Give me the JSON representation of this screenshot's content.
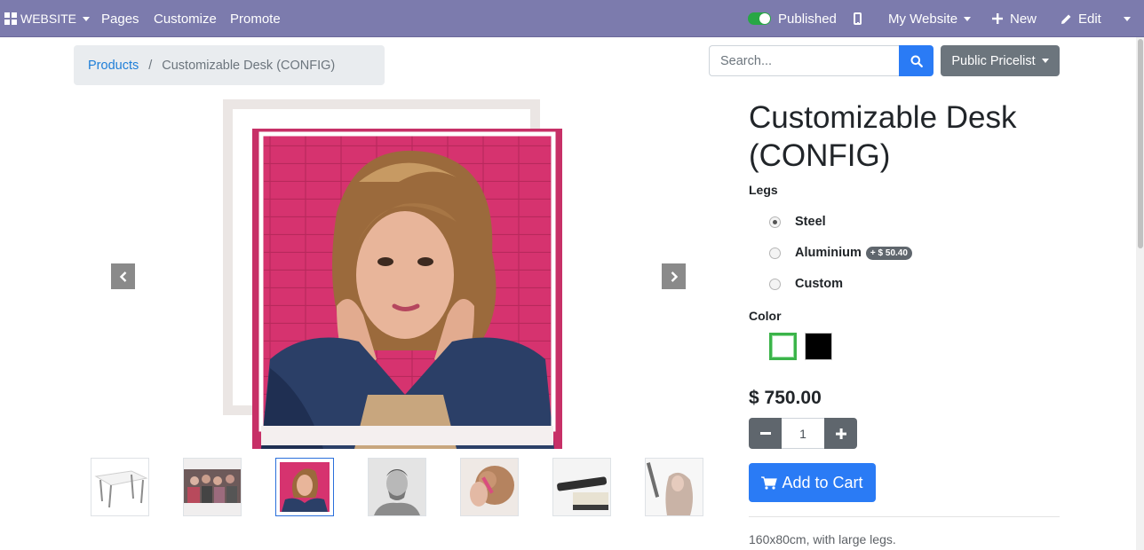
{
  "topbar": {
    "app_menu_label": "WEBSITE",
    "menu_items": [
      {
        "label": "Pages"
      },
      {
        "label": "Customize"
      },
      {
        "label": "Promote"
      }
    ],
    "published_label": "Published",
    "published": true,
    "website_selector_label": "My Website",
    "new_label": "New",
    "edit_label": "Edit",
    "background_color": "#7c7bad"
  },
  "breadcrumb": {
    "parent": "Products",
    "separator": "/",
    "current": "Customizable Desk (CONFIG)"
  },
  "search": {
    "placeholder": "Search...",
    "value": ""
  },
  "pricelist": {
    "label": "Public Pricelist"
  },
  "carousel": {
    "active_index": 2,
    "thumbnails": [
      {
        "subject": "white desk"
      },
      {
        "subject": "group photo"
      },
      {
        "subject": "woman pink wall"
      },
      {
        "subject": "man portrait"
      },
      {
        "subject": "hair styling"
      },
      {
        "subject": "hair straightener"
      },
      {
        "subject": "curling iron"
      }
    ]
  },
  "product": {
    "title": "Customizable Desk (CONFIG)",
    "legs_label": "Legs",
    "legs_options": [
      {
        "label": "Steel",
        "checked": true,
        "extra": ""
      },
      {
        "label": "Aluminium",
        "checked": false,
        "extra": "+ $ 50.40"
      },
      {
        "label": "Custom",
        "checked": false,
        "extra": ""
      }
    ],
    "color_label": "Color",
    "colors": [
      {
        "name": "white",
        "hex": "#ffffff",
        "selected": true
      },
      {
        "name": "black",
        "hex": "#000000",
        "selected": false
      }
    ],
    "price": "$ 750.00",
    "quantity": "1",
    "add_to_cart_label": "Add to Cart",
    "description": "160x80cm, with large legs."
  },
  "colors": {
    "primary": "#2a7bf5",
    "secondary": "#6c757d",
    "link": "#1e7ed8",
    "selected_swatch_border": "#3bb44a"
  }
}
